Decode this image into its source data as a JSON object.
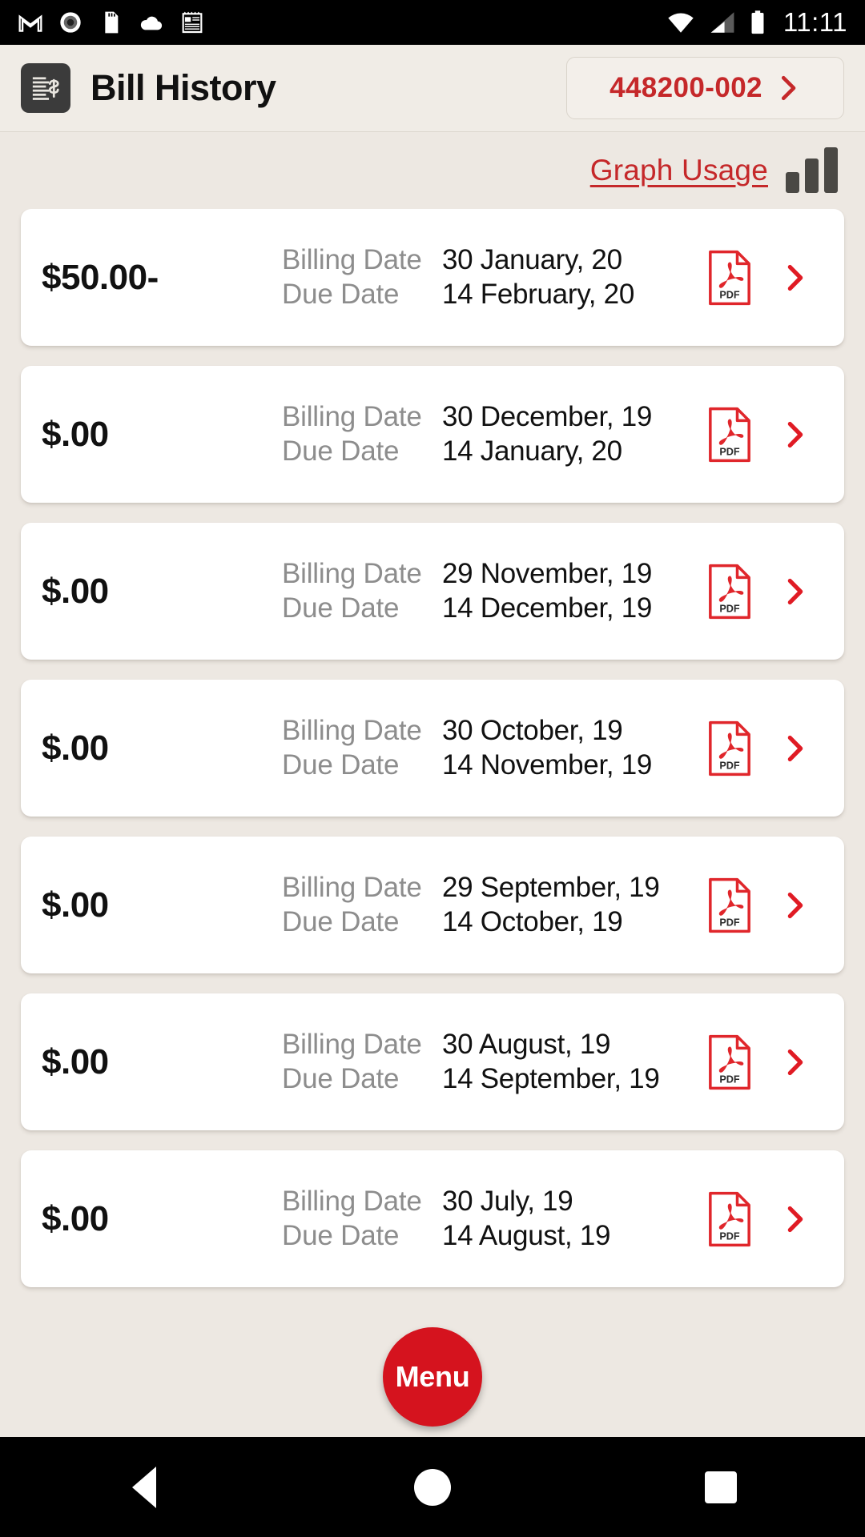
{
  "statusbar": {
    "time": "11:11",
    "left_icons": [
      "gmail-icon",
      "record-icon",
      "sdcard-icon",
      "cloud-icon",
      "notepad-icon"
    ],
    "right_icons": [
      "wifi-icon",
      "cellular-signal-icon",
      "battery-icon"
    ]
  },
  "header": {
    "icon": "bill-document-icon",
    "title": "Bill History",
    "account": {
      "number": "448200-002",
      "chevron": "chevron-right-icon"
    }
  },
  "usage": {
    "link_label": "Graph Usage",
    "bars_icon": "bar-chart-icon"
  },
  "labels": {
    "billing_date": "Billing Date",
    "due_date": "Due Date",
    "pdf": "PDF"
  },
  "bills": [
    {
      "amount": "$50.00-",
      "billing_date": "30 January, 20",
      "due_date": "14 February, 20"
    },
    {
      "amount": "$.00",
      "billing_date": "30 December, 19",
      "due_date": "14 January, 20"
    },
    {
      "amount": "$.00",
      "billing_date": "29 November, 19",
      "due_date": "14 December, 19"
    },
    {
      "amount": "$.00",
      "billing_date": "30 October, 19",
      "due_date": "14 November, 19"
    },
    {
      "amount": "$.00",
      "billing_date": "29 September, 19",
      "due_date": "14 October, 19"
    },
    {
      "amount": "$.00",
      "billing_date": "30 August, 19",
      "due_date": "14 September, 19"
    },
    {
      "amount": "$.00",
      "billing_date": "30 July, 19",
      "due_date": "14 August, 19"
    }
  ],
  "fab": {
    "label": "Menu"
  },
  "navbar": {
    "back": "back-triangle-icon",
    "home": "home-circle-icon",
    "recents": "recents-square-icon"
  },
  "colors": {
    "brand_red": "#C5282A",
    "fab_red": "#D5131E",
    "pdf_red": "#E0262B",
    "background": "#EDE8E2",
    "card": "#FFFFFF",
    "label_gray": "#8D8D8D",
    "icon_dark": "#3B3B3B"
  }
}
